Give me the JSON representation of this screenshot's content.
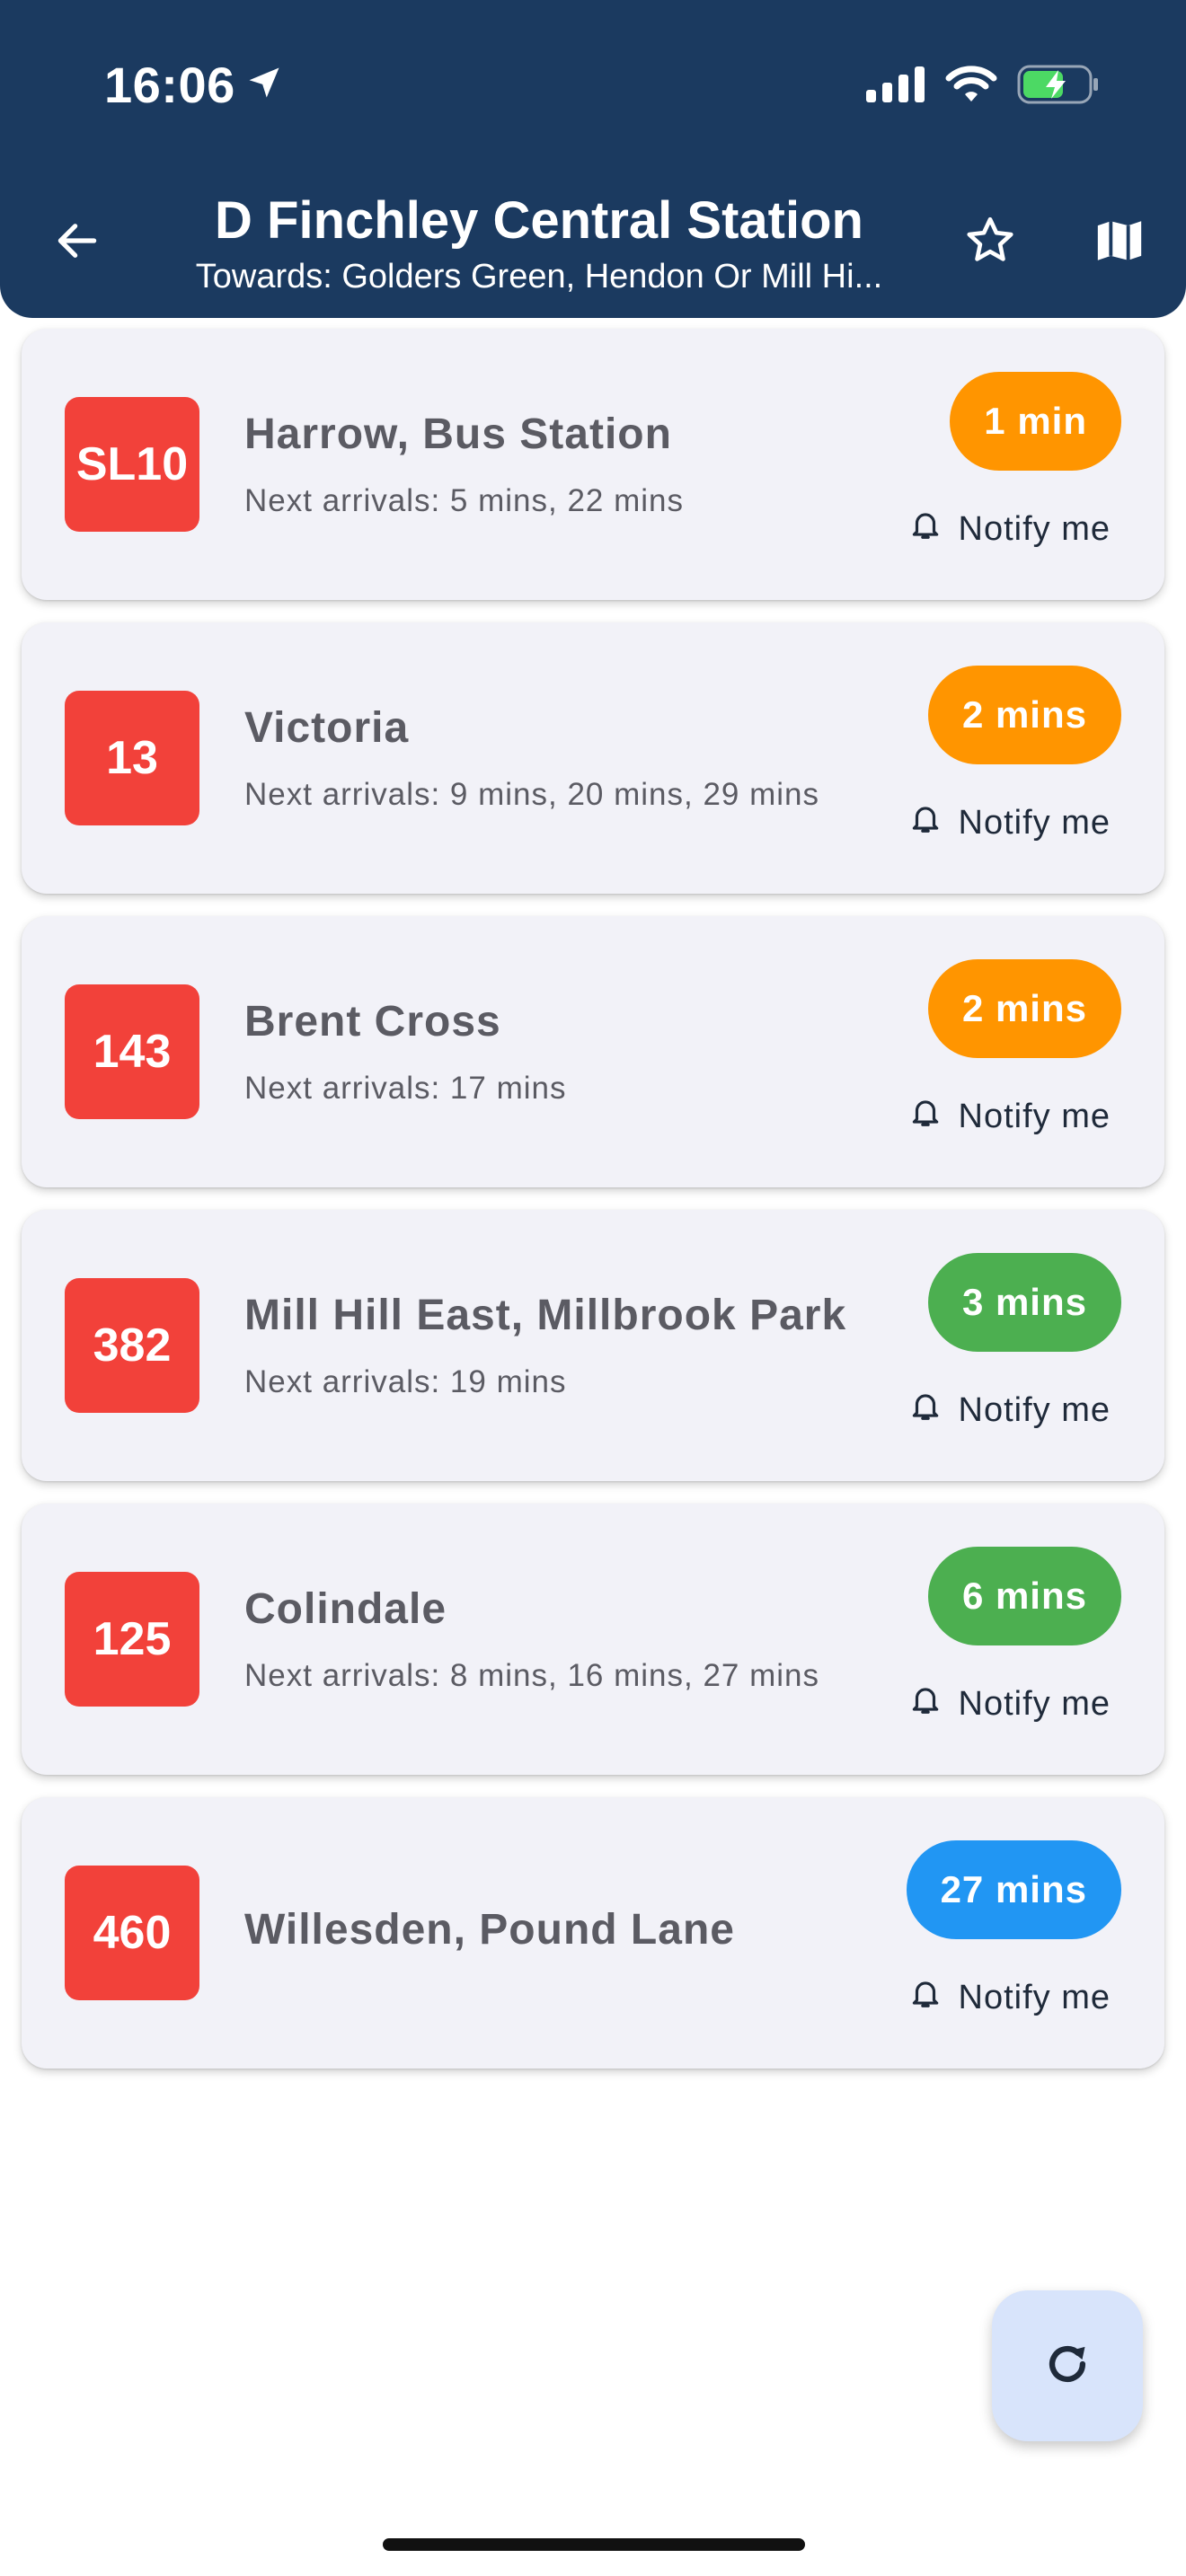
{
  "status_bar": {
    "time": "16:06"
  },
  "header": {
    "title": "D Finchley Central Station",
    "subtitle": "Towards: Golders Green, Hendon Or Mill Hi..."
  },
  "colors": {
    "header_bg": "#1b3a60",
    "route_badge": "#f2413a",
    "eta_orange": "#ff9500",
    "eta_green": "#4caf50",
    "eta_blue": "#2196f3",
    "card_bg": "#f2f2f8",
    "fab_bg": "#d8e4fb"
  },
  "arrivals": [
    {
      "route": "SL10",
      "destination": "Harrow, Bus Station",
      "next": "Next arrivals: 5 mins, 22 mins",
      "eta": "1 min",
      "eta_color": "#ff9500",
      "notify": "Notify me"
    },
    {
      "route": "13",
      "destination": "Victoria",
      "next": "Next arrivals: 9 mins, 20 mins, 29 mins",
      "eta": "2 mins",
      "eta_color": "#ff9500",
      "notify": "Notify me"
    },
    {
      "route": "143",
      "destination": "Brent Cross",
      "next": "Next arrivals: 17 mins",
      "eta": "2 mins",
      "eta_color": "#ff9500",
      "notify": "Notify me"
    },
    {
      "route": "382",
      "destination": "Mill Hill East, Millbrook Park",
      "next": "Next arrivals: 19 mins",
      "eta": "3 mins",
      "eta_color": "#4caf50",
      "notify": "Notify me"
    },
    {
      "route": "125",
      "destination": "Colindale",
      "next": "Next arrivals: 8 mins, 16 mins, 27 mins",
      "eta": "6 mins",
      "eta_color": "#4caf50",
      "notify": "Notify me"
    },
    {
      "route": "460",
      "destination": "Willesden, Pound Lane",
      "next": "",
      "eta": "27 mins",
      "eta_color": "#2196f3",
      "notify": "Notify me"
    }
  ],
  "icons": {
    "back": "arrow-left-icon",
    "favorite": "star-outline-icon",
    "map": "map-icon",
    "notify": "bell-icon",
    "refresh": "refresh-icon"
  }
}
